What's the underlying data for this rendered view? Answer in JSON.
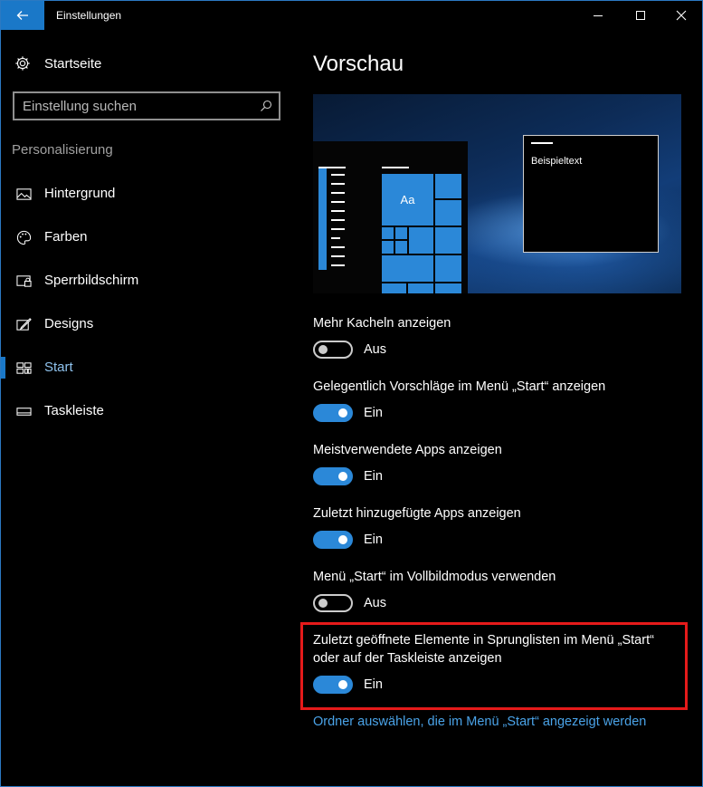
{
  "window": {
    "title": "Einstellungen"
  },
  "sidebar": {
    "home_label": "Startseite",
    "search": {
      "placeholder": "Einstellung suchen"
    },
    "section_label": "Personalisierung",
    "items": [
      {
        "label": "Hintergrund",
        "icon": "picture-icon"
      },
      {
        "label": "Farben",
        "icon": "palette-icon"
      },
      {
        "label": "Sperrbildschirm",
        "icon": "lock-screen-icon"
      },
      {
        "label": "Designs",
        "icon": "designs-icon"
      },
      {
        "label": "Start",
        "icon": "start-icon",
        "selected": true
      },
      {
        "label": "Taskleiste",
        "icon": "taskbar-icon"
      }
    ]
  },
  "main": {
    "title": "Vorschau",
    "preview": {
      "tile_text": "Aa",
      "window_text": "Beispieltext"
    },
    "settings": [
      {
        "label": "Mehr Kacheln anzeigen",
        "state": "Aus",
        "on": false
      },
      {
        "label": "Gelegentlich Vorschläge im Menü „Start“ anzeigen",
        "state": "Ein",
        "on": true
      },
      {
        "label": "Meistverwendete Apps anzeigen",
        "state": "Ein",
        "on": true
      },
      {
        "label": "Zuletzt hinzugefügte Apps anzeigen",
        "state": "Ein",
        "on": true
      },
      {
        "label": "Menü „Start“ im Vollbildmodus verwenden",
        "state": "Aus",
        "on": false
      },
      {
        "label": "Zuletzt geöffnete Elemente in Sprunglisten im Menü „Start“ oder auf der Taskleiste anzeigen",
        "state": "Ein",
        "on": true,
        "highlighted": true
      }
    ],
    "link": "Ordner auswählen, die im Menü „Start“ angezeigt werden"
  },
  "colors": {
    "accent": "#2b88d8",
    "highlight": "#e51a1a",
    "link": "#4aa3e8"
  }
}
